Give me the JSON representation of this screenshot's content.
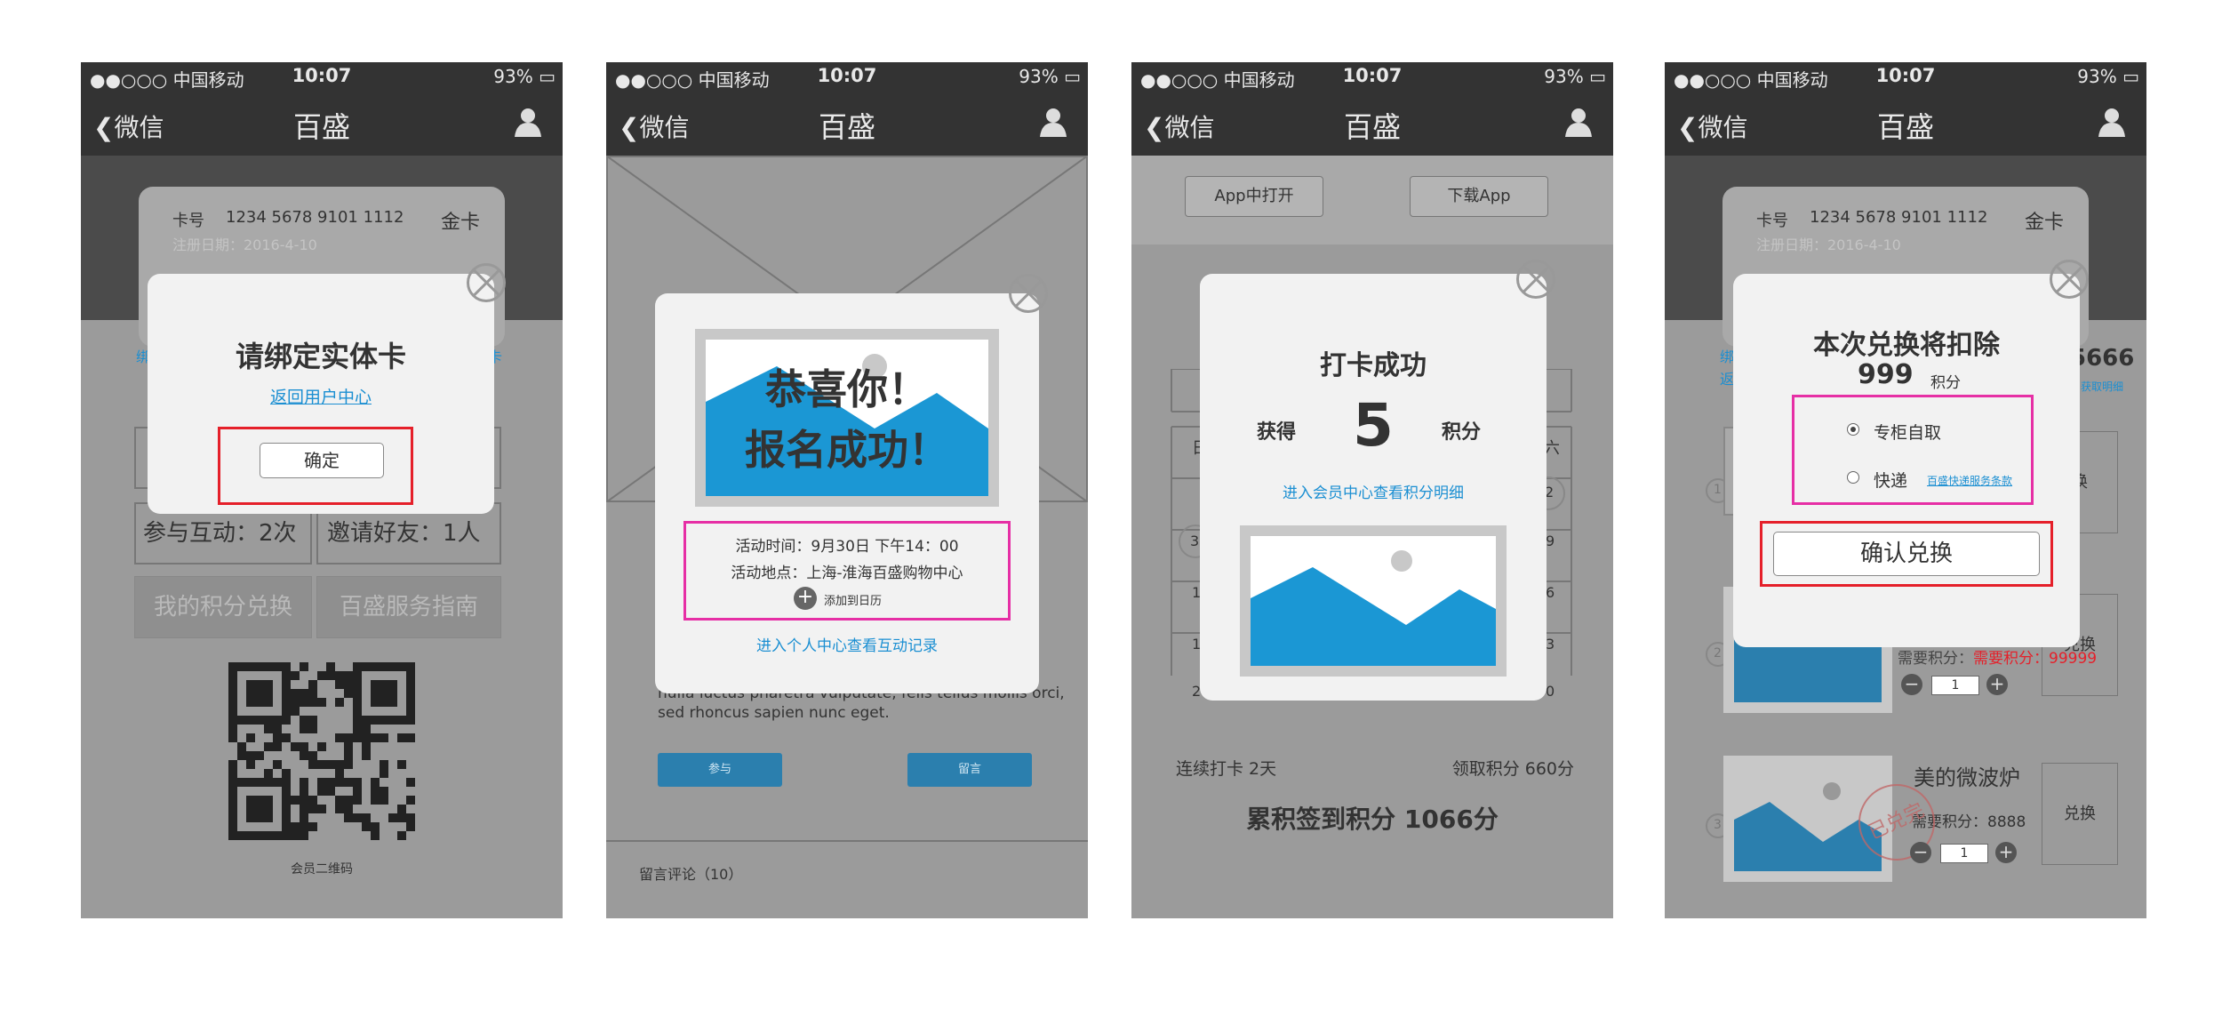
{
  "status": {
    "signal": "●●○○○ 中国移动",
    "time": "10:07",
    "battery": "93%"
  },
  "nav": {
    "back": "微信",
    "title": "百盛"
  },
  "screen1": {
    "card_no_label": "卡号",
    "card_no": "1234 5678 9101 1112",
    "card_level": "金卡",
    "reg_date": "注册日期：2016-4-10",
    "bg_left": "绑",
    "bg_right": "卡",
    "stat1": "参与互动：2次",
    "stat2": "邀请好友：1人",
    "btn1": "我的积分兑换",
    "btn2": "百盛服务指南",
    "qr_caption": "会员二维码",
    "dialog": {
      "title": "请绑定实体卡",
      "link": "返回用户中心",
      "confirm": "确定"
    }
  },
  "screen2": {
    "body_text1": "nulla luctus pharetra vulputate, felis tellus mollis orci,",
    "body_text2": "sed rhoncus sapien nunc eget.",
    "btn_join": "参与",
    "btn_comment": "留言",
    "comments": "留言评论（10）",
    "dialog": {
      "headline1": "恭喜你！",
      "headline2": "报名成功！",
      "time": "活动时间：9月30日 下午14：00",
      "place": "活动地点：上海-淮海百盛购物中心",
      "add_calendar": "添加到日历",
      "link": "进入个人中心查看互动记录"
    }
  },
  "screen3": {
    "btn_open": "App中打开",
    "btn_download": "下载App",
    "cal_partial": {
      "day1": "日",
      "day2": "六",
      "n2": "2",
      "n3": "3",
      "n9": "9",
      "n16": "6",
      "n23": "3",
      "n30": "0",
      "r1": "1",
      "r2": "1",
      "r3": "2"
    },
    "streak": "连续打卡 2天",
    "claimed": "领取积分 660分",
    "total": "累积签到积分 1066分",
    "dialog": {
      "title": "打卡成功",
      "earn_label": "获得",
      "earn_value": "5",
      "earn_unit": "积分",
      "link": "进入会员中心查看积分明细"
    }
  },
  "screen4": {
    "card_no_label": "卡号",
    "card_no": "1234 5678 9101 1112",
    "card_level": "金卡",
    "reg_date": "注册日期：2016-4-10",
    "bg_left1": "绑",
    "bg_left2": "返",
    "points_partial": "5666",
    "points_link": "获取明细",
    "items": [
      {
        "num": "1",
        "action": "换"
      },
      {
        "num": "2",
        "need": "需要积分：99999",
        "qty": "1",
        "action": "兑换"
      },
      {
        "num": "3",
        "name": "美的微波炉",
        "need": "需要积分：8888",
        "qty": "1",
        "action": "兑换",
        "stamp": "已兑完"
      }
    ],
    "dialog": {
      "title": "本次兑换将扣除",
      "amount": "999",
      "unit": "积分",
      "opt1": "专柜自取",
      "opt2": "快递",
      "opt2_link": "百盛快递服务条款",
      "confirm": "确认兑换"
    }
  }
}
